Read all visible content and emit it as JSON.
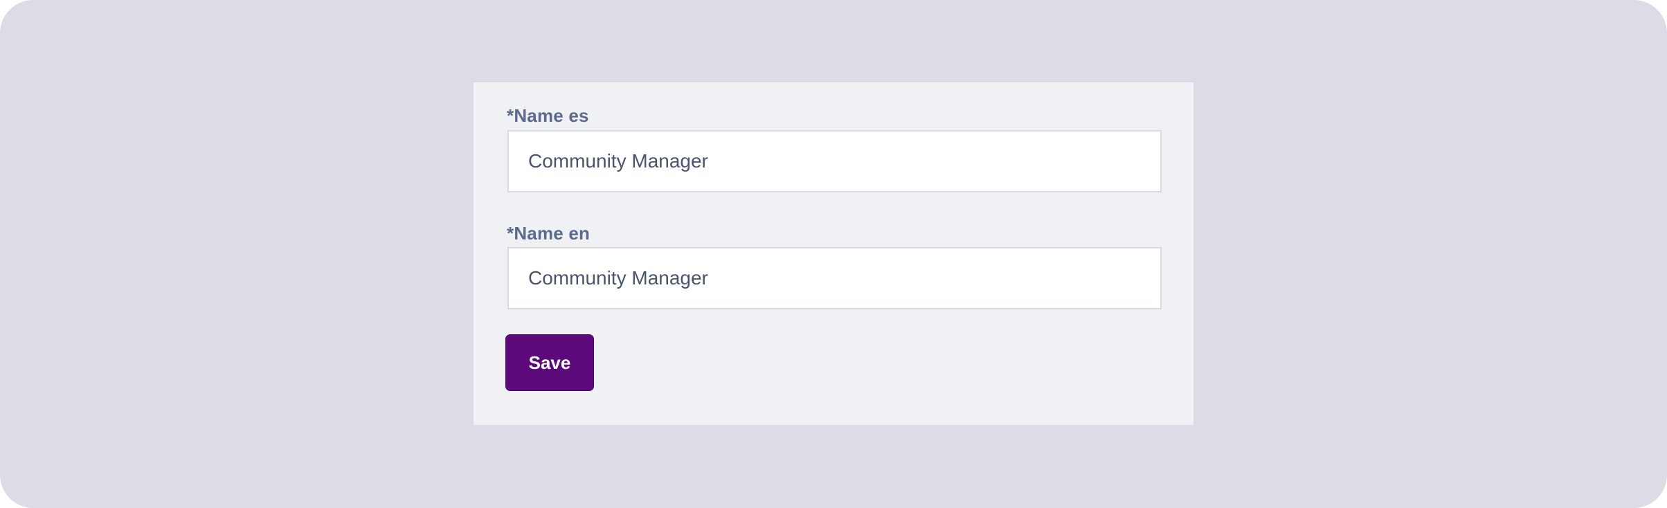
{
  "form": {
    "name_es": {
      "label": "*Name es",
      "value": "Community Manager"
    },
    "name_en": {
      "label": "*Name en",
      "value": "Community Manager"
    },
    "save_label": "Save"
  },
  "colors": {
    "background": "#dcdce7",
    "card": "#f0f1f4",
    "label": "#5b6a8d",
    "input_text": "#4a556d",
    "input_border": "#d8dbe3",
    "primary_button": "#5c0a7b"
  }
}
